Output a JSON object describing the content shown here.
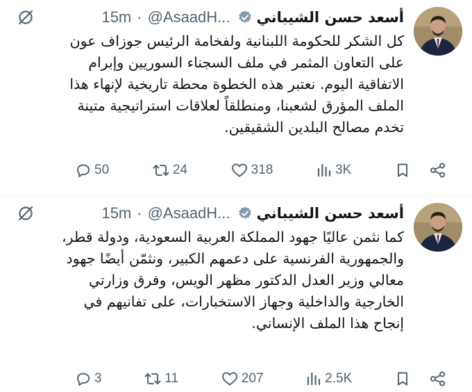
{
  "colors": {
    "text": "#0f1419",
    "secondary": "#536471",
    "verified_badge": "#829aab",
    "divider": "#eff3f4"
  },
  "tweets": [
    {
      "author": {
        "display_name": "أسعد حسن الشيباني",
        "handle": "@AsaadH...",
        "verified": true
      },
      "time": "15m",
      "separator": "·",
      "text_lines": [
        "كل الشكر للحكومة اللبنانية ولفخامة الرئيس جوزاف عون",
        "على التعاون المثمر في ملف السجناء السوريين وإبرام",
        "الاتفاقية اليوم. نعتبر هذه الخطوة محطة تاريخية لإنهاء هذا",
        "الملف المؤرق لشعبنا، ومنطلقاً لعلاقات استراتيجية متينة",
        "تخدم مصالح البلدين الشقيقين."
      ],
      "stats": {
        "replies": "50",
        "reposts": "24",
        "likes": "318",
        "views": "3K"
      },
      "icons": [
        "grok-icon",
        "reply-icon",
        "repost-icon",
        "like-icon",
        "views-icon",
        "bookmark-icon",
        "share-icon",
        "verified-badge-icon"
      ]
    },
    {
      "author": {
        "display_name": "أسعد حسن الشيباني",
        "handle": "@AsaadH...",
        "verified": true
      },
      "time": "15m",
      "separator": "·",
      "text_lines": [
        "كما نثمن عاليًا جهود المملكة العربية السعودية، ودولة قطر،",
        "والجمهورية الفرنسية على دعمهم الكبير، ونثمّن أيضًا جهود",
        "معالي وزير العدل الدكتور مظهر الويس، وفرق وزارتي",
        "الخارجية والداخلية وجهاز الاستخبارات، على تفانيهم في",
        "إنجاح هذا الملف الإنساني."
      ],
      "stats": {
        "replies": "3",
        "reposts": "11",
        "likes": "207",
        "views": "2.5K"
      },
      "icons": [
        "grok-icon",
        "reply-icon",
        "repost-icon",
        "like-icon",
        "views-icon",
        "bookmark-icon",
        "share-icon",
        "verified-badge-icon"
      ]
    }
  ]
}
